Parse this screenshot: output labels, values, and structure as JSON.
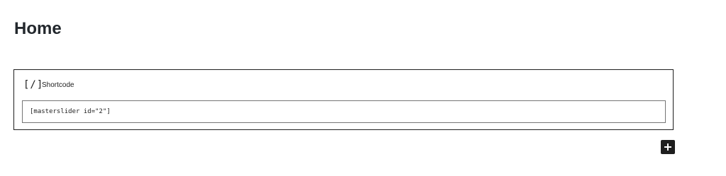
{
  "page": {
    "title": "Home"
  },
  "block": {
    "icon_text": "[/]",
    "label": "Shortcode",
    "value": "[masterslider id=\"2\"]"
  },
  "add_button": {
    "icon": "plus-icon",
    "color": "#1e1e1e"
  }
}
